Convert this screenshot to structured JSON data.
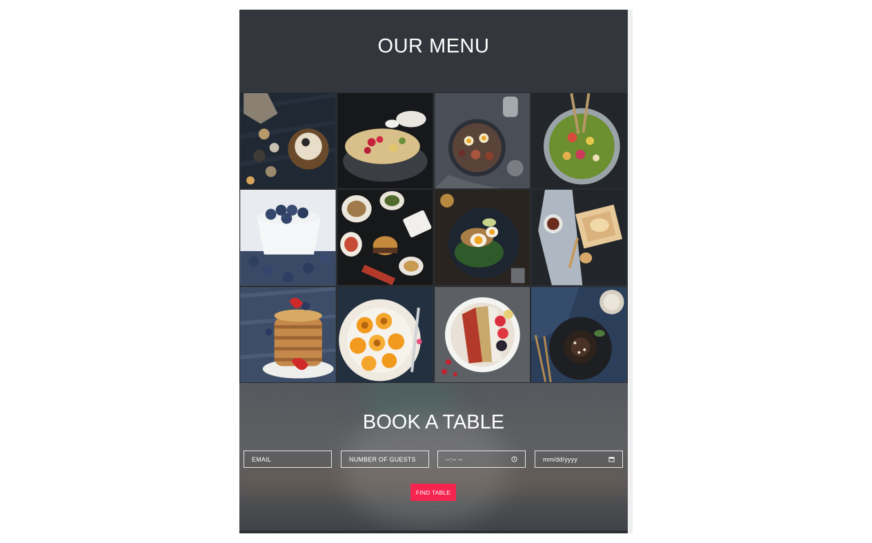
{
  "menu": {
    "title": "OUR MENU",
    "items": [
      {
        "icon": "breakfast-table-photo"
      },
      {
        "icon": "grain-bowl-photo"
      },
      {
        "icon": "figs-eggs-plate-photo"
      },
      {
        "icon": "green-salad-bowl-photo"
      },
      {
        "icon": "blueberries-bowl-photo"
      },
      {
        "icon": "burger-platter-photo"
      },
      {
        "icon": "egg-toast-photo"
      },
      {
        "icon": "pastry-dip-photo"
      },
      {
        "icon": "pancake-stack-photo"
      },
      {
        "icon": "peach-plate-photo"
      },
      {
        "icon": "berry-smoothie-bowl-photo"
      },
      {
        "icon": "chocolate-dessert-photo"
      }
    ]
  },
  "booking": {
    "title": "BOOK A TABLE",
    "email_placeholder": "EMAIL",
    "guests_placeholder": "NUMBER OF GUESTS",
    "time_value": "--:-- --",
    "date_value": "mm/dd/yyyy",
    "submit_label": "FIND TABLE"
  },
  "colors": {
    "header_bg": "#33373d",
    "accent": "#f5254f",
    "text": "#ffffff"
  }
}
